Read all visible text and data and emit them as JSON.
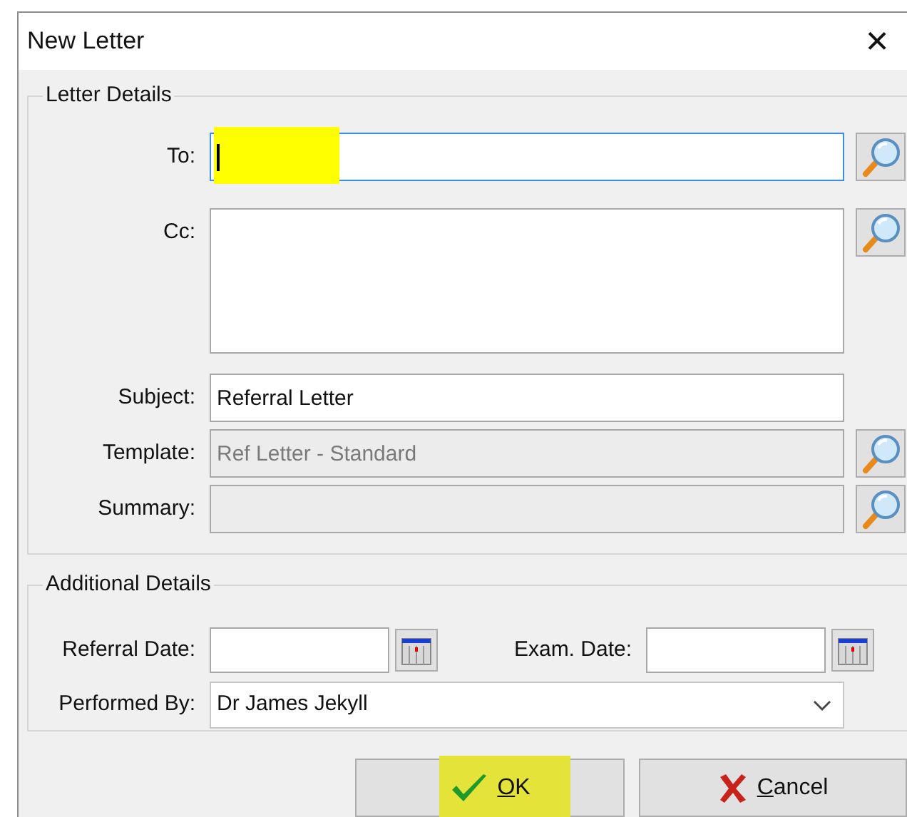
{
  "window": {
    "title": "New Letter",
    "close": "×"
  },
  "letter_details": {
    "title": "Letter Details",
    "fields": [
      {
        "kind": "line",
        "label": "To:",
        "focused": true,
        "disabled": false,
        "highlighted": true,
        "lookup": true
      },
      {
        "kind": "area",
        "label": "Cc:",
        "focused": false,
        "disabled": false,
        "highlighted": false,
        "lookup": true
      },
      {
        "kind": "line",
        "label": "Subject:",
        "value": "Referral Letter",
        "focused": false,
        "disabled": false,
        "highlighted": false,
        "lookup": false
      },
      {
        "kind": "line",
        "label": "Template:",
        "value": "Ref Letter - Standard",
        "focused": false,
        "disabled": true,
        "highlighted": false,
        "lookup": true
      },
      {
        "kind": "line",
        "label": "Summary:",
        "focused": false,
        "disabled": true,
        "highlighted": false,
        "lookup": true
      }
    ]
  },
  "additional_details": {
    "title": "Additional Details",
    "dates": [
      {
        "label": "Referral Date:"
      },
      {
        "label": "Exam. Date:"
      }
    ],
    "performed_by": {
      "label": "Performed By:",
      "value": "Dr James Jekyll"
    }
  },
  "buttons": [
    {
      "kind": "ok",
      "accel": "O",
      "rest": "K",
      "highlighted": true
    },
    {
      "kind": "cancel",
      "accel": "C",
      "rest": "ancel",
      "highlighted": false
    }
  ]
}
